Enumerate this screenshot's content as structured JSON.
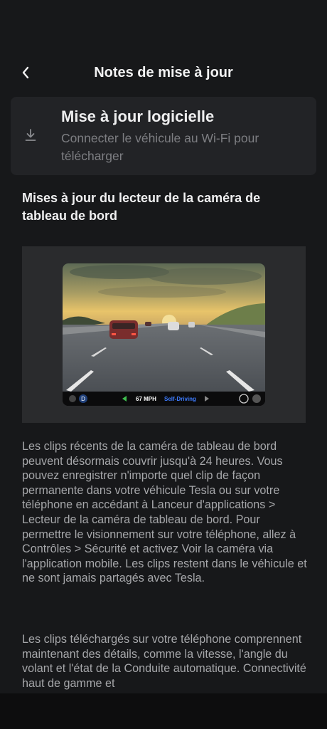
{
  "header": {
    "title": "Notes de mise à jour"
  },
  "update_card": {
    "title": "Mise à jour logicielle",
    "subtitle": "Connecter le véhicule au Wi-Fi pour télécharger"
  },
  "section": {
    "title": "Mises à jour du lecteur de la caméra de tableau de bord"
  },
  "video_overlay": {
    "gear": "D",
    "speed": "67 MPH",
    "mode": "Self-Driving"
  },
  "body": {
    "paragraph1": "Les clips récents de la caméra de tableau de bord peuvent désormais couvrir jusqu'à 24 heures. Vous pouvez enregistrer n'importe quel clip de façon permanente dans votre véhicule Tesla ou sur votre téléphone en accédant à Lanceur d'applications > Lecteur de la caméra de tableau de bord.  Pour permettre le visionnement sur votre téléphone, allez à Contrôles > Sécurité et activez Voir la caméra via l'application mobile.  Les clips restent dans le véhicule et ne sont jamais partagés avec Tesla.",
    "paragraph2": "Les clips téléchargés sur votre téléphone comprennent maintenant des détails, comme la vitesse, l'angle du volant et l'état de la Conduite automatique.  Connectivité haut de gamme et"
  }
}
